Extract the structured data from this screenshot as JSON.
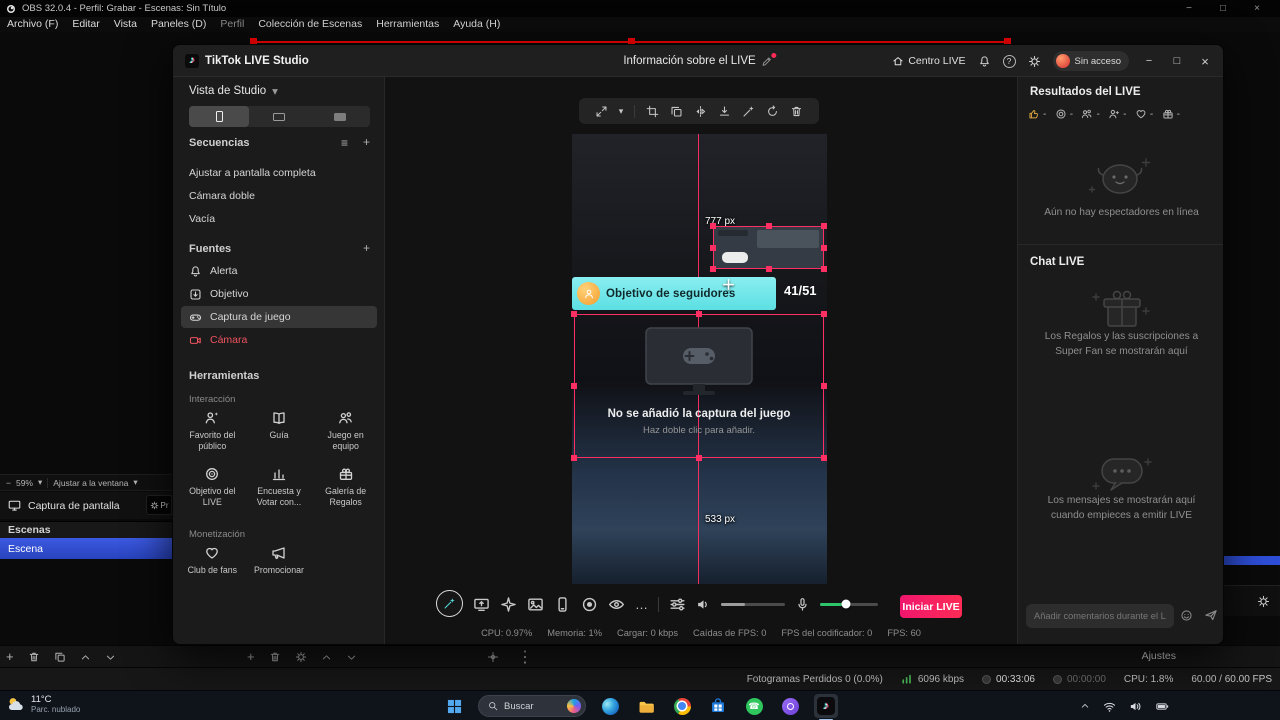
{
  "icons": {
    "chevron_down": "▾",
    "chevron_up": "▴",
    "list": "≡",
    "plus": "+",
    "more": "…",
    "kebab": "⋮",
    "close": "×",
    "minimize": "−",
    "maximize": "□",
    "question": "?",
    "dash": "-",
    "note": "♪",
    "phone_glyph": "☎"
  },
  "obs": {
    "title": "OBS 32.0.4 - Perfil: Grabar - Escenas: Sin Título",
    "menu": [
      "Archivo (F)",
      "Editar",
      "Vista",
      "Paneles (D)",
      "Perfil",
      "Colección de Escenas",
      "Herramientas",
      "Ayuda (H)"
    ],
    "preview": {
      "zoom": "59%",
      "fit": "Ajustar a la ventana"
    },
    "source_row": {
      "label": "Captura de pantalla",
      "props": "Pr"
    },
    "scenes": {
      "header": "Escenas",
      "selected": "Escena"
    },
    "controls": {
      "settings": "Ajustes"
    },
    "status": {
      "dropped": "Fotogramas Perdidos 0 (0.0%)",
      "bitrate": "6096 kbps",
      "rec_time": "00:33:06",
      "live_time": "00:00:00",
      "cpu": "CPU: 1.8%",
      "fps": "60.00 / 60.00 FPS"
    }
  },
  "studio": {
    "title": "TikTok LIVE Studio",
    "header": {
      "center": "Información sobre el LIVE",
      "live_center": "Centro LIVE",
      "access": "Sin acceso"
    },
    "sidebar": {
      "view": "Vista de Studio",
      "sequences_title": "Secuencias",
      "sequences": [
        "Ajustar a pantalla completa",
        "Cámara doble",
        "Vacía"
      ],
      "sources_title": "Fuentes",
      "sources": [
        "Alerta",
        "Objetivo",
        "Captura de juego",
        "Cámara"
      ],
      "tools_title": "Herramientas",
      "interaction_label": "Interacción",
      "tools": [
        "Favorito del público",
        "Guía",
        "Juego en equipo",
        "Objetivo del LIVE",
        "Encuesta y Votar con...",
        "Galería de Regalos"
      ],
      "monetization_label": "Monetización",
      "monetization": [
        "Club de fans",
        "Promocionar"
      ]
    },
    "canvas": {
      "width_label": "777 px",
      "height_label": "533 px",
      "goal_label": "Objetivo de seguidores",
      "goal_value": "41/51",
      "capture_title": "No se añadió la captura del juego",
      "capture_hint": "Haz doble clic para añadir.",
      "start_button": "Iniciar LIVE",
      "status": [
        "CPU: 0.97%",
        "Memoria: 1%",
        "Cargar: 0 kbps",
        "Caídas de FPS: 0",
        "FPS del codificador: 0",
        "FPS: 60"
      ]
    },
    "panel": {
      "results_title": "Resultados del LIVE",
      "stat_value": "-",
      "empty_viewers": "Aún no hay espectadores en línea",
      "chat_title": "Chat LIVE",
      "gifts_hint": "Los Regalos y las suscripciones a Super Fan se mostrarán aquí",
      "messages_hint": "Los mensajes se mostrarán aquí cuando empieces a emitir LIVE",
      "comment_placeholder": "Añadir comentarios durante el LIVE"
    }
  },
  "taskbar": {
    "temp": "11°C",
    "weather": "Parc. nublado",
    "search": "Buscar"
  },
  "colors": {
    "accent_pink": "#fe2c55",
    "selection_pink": "#ff2e63",
    "banner_cyan": "#79e8ea",
    "scene_blue": "#2e4ed8",
    "meter_green": "#2ec46a"
  }
}
